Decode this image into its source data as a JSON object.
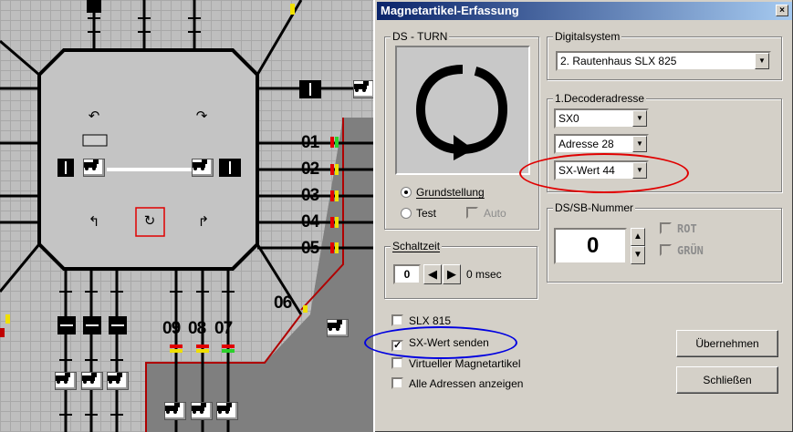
{
  "layout_view": {
    "track_numbers": [
      "01",
      "02",
      "03",
      "04",
      "05",
      "06",
      "09",
      "08",
      "07"
    ]
  },
  "dialog": {
    "title": "Magnetartikel-Erfassung",
    "close_glyph": "×",
    "ds_turn": {
      "legend": "DS - TURN",
      "radio_grundstellung": "Grundstellung",
      "radio_test": "Test",
      "check_auto": "Auto"
    },
    "digitalsystem": {
      "legend": "Digitalsystem",
      "value": "2. Rautenhaus SLX 825"
    },
    "decoder": {
      "legend": "1.Decoderadresse",
      "sx": "SX0",
      "adresse": "Adresse 28",
      "sx_wert": "SX-Wert 44"
    },
    "schaltzeit": {
      "legend": "Schaltzeit",
      "value": "0",
      "unit": "0 msec"
    },
    "ds_sb": {
      "legend": "DS/SB-Nummer",
      "value": "0",
      "rot": "ROT",
      "gruen": "GRÜN"
    },
    "checks": {
      "slx815": "SLX 815",
      "sx_wert_senden": "SX-Wert senden",
      "virtueller": "Virtueller Magnetartikel",
      "alle_adressen": "Alle Adressen anzeigen"
    },
    "buttons": {
      "uebernehmen": "Übernehmen",
      "schliessen": "Schließen"
    },
    "highlight_colors": {
      "red_oval": "#e00000",
      "blue_oval": "#0000e0"
    }
  }
}
